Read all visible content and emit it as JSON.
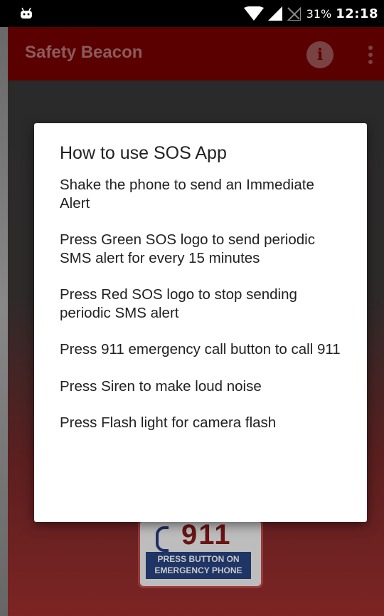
{
  "status_bar": {
    "battery": "31%",
    "time": "12:18",
    "icons": [
      "android-icon",
      "wifi-icon",
      "signal-icon",
      "no-sim-icon"
    ]
  },
  "app_bar": {
    "title": "Safety Beacon",
    "info_icon": "info-icon",
    "menu_icon": "more-vert-icon"
  },
  "dialog": {
    "title": "How to use SOS App",
    "lines": [
      "Shake the phone to send an Immediate Alert",
      "Press Green SOS logo to send periodic SMS alert for every 15 minutes",
      "Press Red SOS logo to stop sending periodic SMS alert",
      "Press 911 emergency call button to call 911",
      "Press Siren to make loud noise",
      "Press Flash light for camera flash"
    ]
  },
  "background": {
    "emergency_card": {
      "number": "911",
      "label_line1": "PRESS BUTTON ON",
      "label_line2": "EMERGENCY PHONE"
    }
  },
  "colors": {
    "app_bar": "#5a0000",
    "dialog_bg": "#ffffff",
    "status_bar": "#000000"
  }
}
